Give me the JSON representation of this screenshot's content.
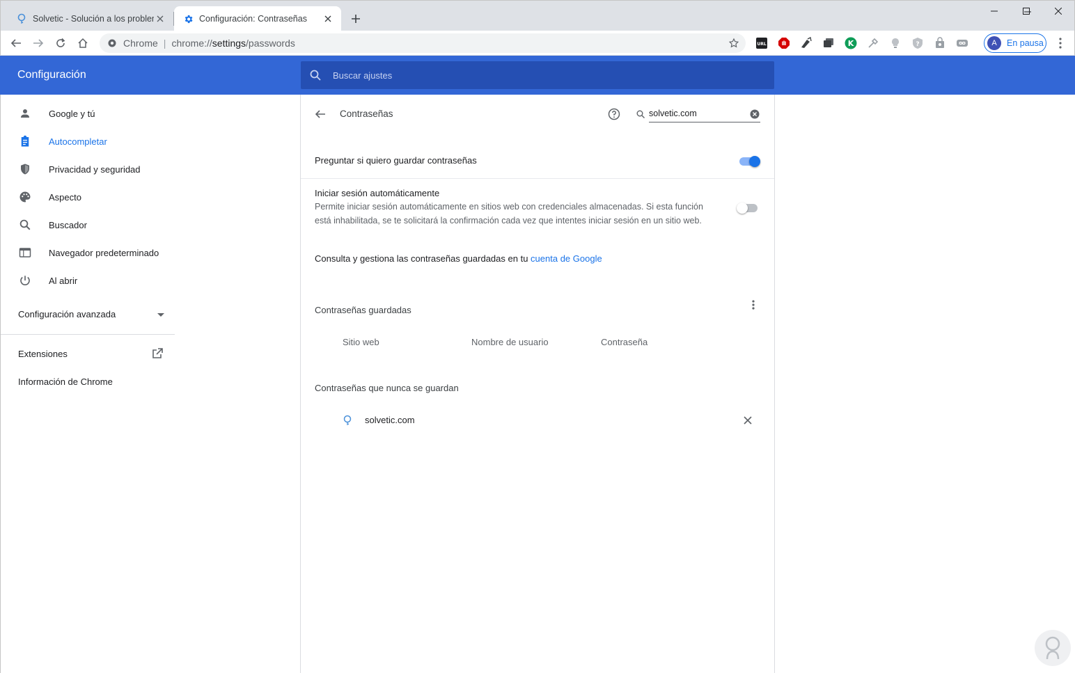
{
  "tabs": [
    {
      "title": "Solvetic - Solución a los problem",
      "active": false
    },
    {
      "title": "Configuración: Contraseñas",
      "active": true
    }
  ],
  "omnibox": {
    "chip": "Chrome",
    "url_scheme": "chrome://",
    "url_host": "settings",
    "url_path": "/passwords"
  },
  "extensions_icons": [
    "url-extension-icon",
    "adblock-icon",
    "pen-tool-icon",
    "tab-manager-icon",
    "k-extension-icon",
    "eyedropper-icon",
    "lightbulb-icon",
    "shield-question-icon",
    "bag-icon",
    "infinity-icon"
  ],
  "profile": {
    "initial": "A",
    "label": "En pausa"
  },
  "header": {
    "title": "Configuración",
    "search_placeholder": "Buscar ajustes"
  },
  "sidebar": {
    "items": [
      {
        "label": "Google y tú",
        "icon": "person-icon"
      },
      {
        "label": "Autocompletar",
        "icon": "clipboard-icon",
        "selected": true
      },
      {
        "label": "Privacidad y seguridad",
        "icon": "shield-icon"
      },
      {
        "label": "Aspecto",
        "icon": "palette-icon"
      },
      {
        "label": "Buscador",
        "icon": "search-icon"
      },
      {
        "label": "Navegador predeterminado",
        "icon": "browser-window-icon"
      },
      {
        "label": "Al abrir",
        "icon": "power-icon"
      }
    ],
    "advanced": "Configuración avanzada",
    "extensions": "Extensiones",
    "about": "Información de Chrome"
  },
  "passwords": {
    "title": "Contraseñas",
    "search_value": "solvetic.com",
    "offer_to_save": {
      "label": "Preguntar si quiero guardar contraseñas",
      "enabled": true
    },
    "auto_signin": {
      "label": "Iniciar sesión automáticamente",
      "desc_line1": "Permite iniciar sesión automáticamente en sitios web con credenciales almacenadas. Si esta función",
      "desc_line2": "está inhabilitada, se te solicitará la confirmación cada vez que intentes iniciar sesión en un sitio web.",
      "enabled": false
    },
    "manage_text": "Consulta y gestiona las contraseñas guardadas en tu ",
    "manage_link": "cuenta de Google",
    "saved_heading": "Contraseñas guardadas",
    "columns": [
      "Sitio web",
      "Nombre de usuario",
      "Contraseña"
    ],
    "never_heading": "Contraseñas que nunca se guardan",
    "never_saved": [
      {
        "site": "solvetic.com"
      }
    ]
  },
  "colors": {
    "accent": "#1a73e8",
    "header_bg": "#3367d6",
    "search_bg": "#254fb3"
  }
}
